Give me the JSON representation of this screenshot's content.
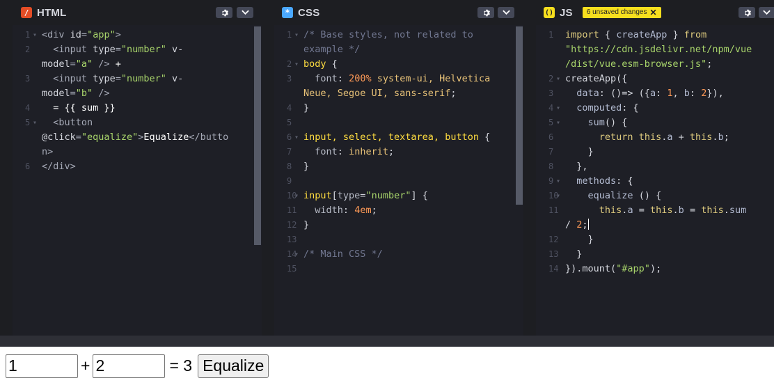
{
  "panes": {
    "html": {
      "title": "HTML",
      "badge_icon": "html-icon",
      "line_numbers": [
        "1",
        "2",
        "",
        "3",
        "",
        "4",
        "5",
        "",
        "",
        "6"
      ],
      "folds": [
        true,
        false,
        false,
        false,
        false,
        false,
        true,
        false,
        false,
        false
      ]
    },
    "css": {
      "title": "CSS",
      "badge_icon": "css-icon",
      "line_numbers": [
        "1",
        "",
        "2",
        "3",
        "",
        "4",
        "5",
        "6",
        "7",
        "8",
        "9",
        "10",
        "11",
        "12",
        "13",
        "14",
        "15"
      ],
      "folds": [
        true,
        false,
        true,
        false,
        false,
        false,
        false,
        true,
        false,
        false,
        false,
        true,
        false,
        false,
        false,
        true,
        false
      ]
    },
    "js": {
      "title": "JS",
      "badge_icon": "js-icon",
      "unsaved_label": "6 unsaved changes",
      "line_numbers": [
        "1",
        "",
        "",
        "2",
        "3",
        "4",
        "5",
        "6",
        "7",
        "8",
        "9",
        "10",
        "11",
        "",
        "12",
        "13",
        "14"
      ],
      "folds": [
        false,
        false,
        false,
        true,
        false,
        true,
        true,
        false,
        false,
        false,
        true,
        true,
        false,
        false,
        false,
        false,
        false
      ]
    }
  },
  "icons": {
    "settings": "gear-icon",
    "collapse": "chevron-down-icon",
    "dismiss": "close-icon"
  },
  "colors": {
    "html_badge": "#e44d26",
    "css_badge": "#4aa8ff",
    "js_badge": "#f7df1e",
    "editor_bg": "#1e1f26"
  },
  "result": {
    "a_value": "1",
    "b_value": "2",
    "plus": "+",
    "equals": "= 3",
    "button_label": "Equalize"
  }
}
